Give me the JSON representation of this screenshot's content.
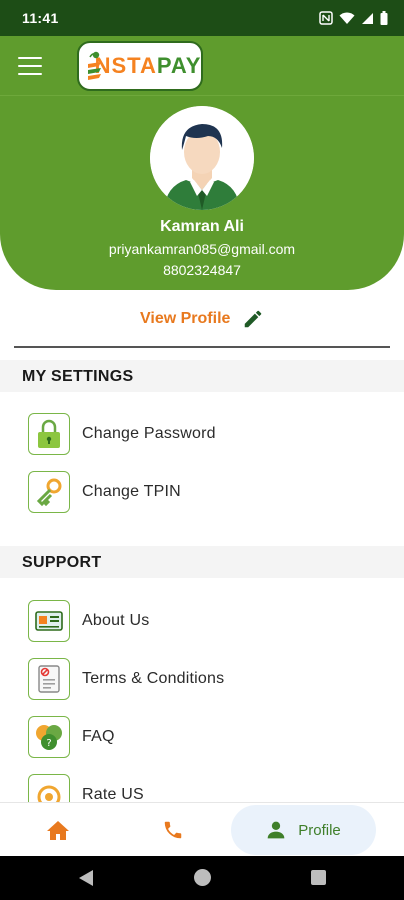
{
  "status_bar": {
    "time": "11:41"
  },
  "app": {
    "logo_text_accent": "NSTA",
    "logo_text_green": "PAY"
  },
  "profile": {
    "name": "Kamran Ali",
    "email": "priyankamran085@gmail.com",
    "phone": "8802324847",
    "view_profile_label": "View Profile"
  },
  "settings": {
    "title": "MY SETTINGS",
    "items": [
      {
        "label": "Change Password",
        "icon": "lock-icon"
      },
      {
        "label": "Change TPIN",
        "icon": "key-icon"
      }
    ]
  },
  "support": {
    "title": "SUPPORT",
    "items": [
      {
        "label": "About Us",
        "icon": "about-icon"
      },
      {
        "label": "Terms & Conditions",
        "icon": "terms-icon"
      },
      {
        "label": "FAQ",
        "icon": "faq-icon"
      },
      {
        "label": "Rate US",
        "icon": "rate-icon"
      }
    ]
  },
  "bottom_nav": {
    "profile_label": "Profile"
  },
  "colors": {
    "header_green": "#5f9c2d",
    "status_bar": "#1d4d16",
    "accent_orange": "#e8791e",
    "active_tab_bg": "#eaf2fb"
  }
}
